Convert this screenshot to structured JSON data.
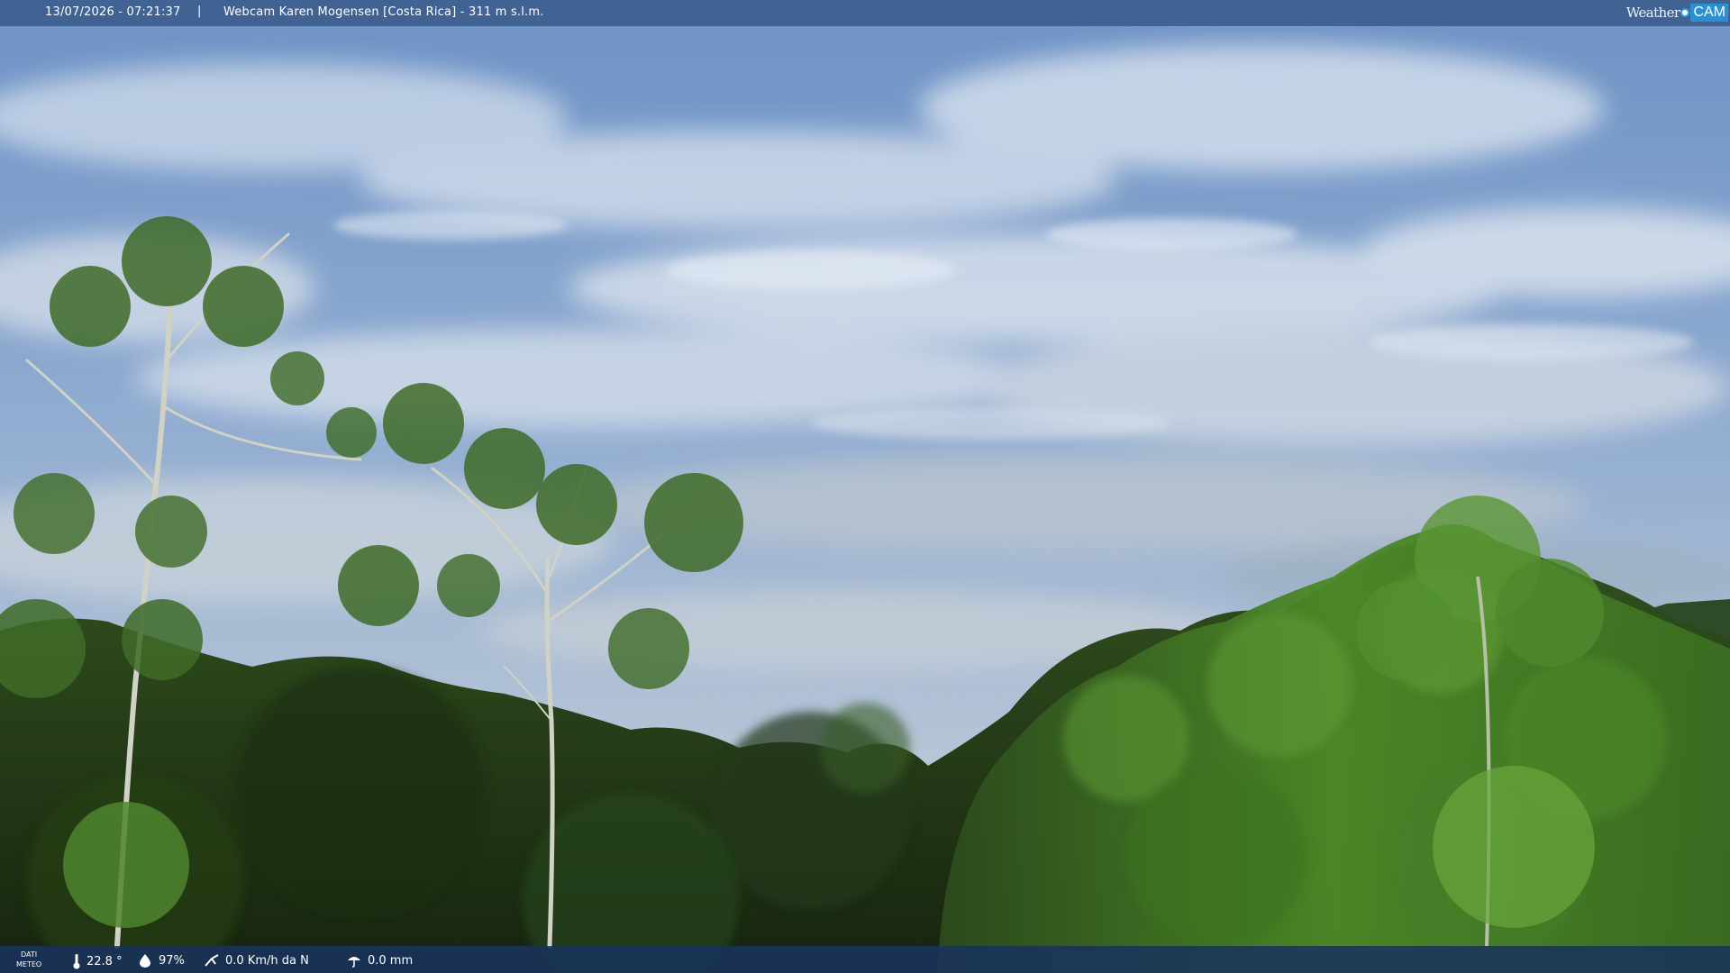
{
  "overlay": {
    "timestamp": "13/07/2026 - 07:21:37",
    "separator": "|",
    "title": "Webcam Karen Mogensen [Costa Rica] - 311 m s.l.m.",
    "brand_weather": "Weather",
    "brand_cam": "CAM"
  },
  "weather_data": {
    "label_line1": "DATI",
    "label_line2": "METEO",
    "temperature": "22.8 °",
    "humidity": "97%",
    "wind": "0.0 Km/h da N",
    "rain": "0.0 mm"
  },
  "icons": [
    "thermometer-icon",
    "humidity-drop-icon",
    "wind-icon",
    "rain-icon"
  ],
  "colors": {
    "sky_top": "#5d86bd",
    "sky_bottom": "#aebdd0",
    "foliage_dark": "#1c2a18",
    "foliage_light": "#4d8a2a",
    "bar_top": "#3a5c8c",
    "bar_bottom": "#18325c"
  }
}
